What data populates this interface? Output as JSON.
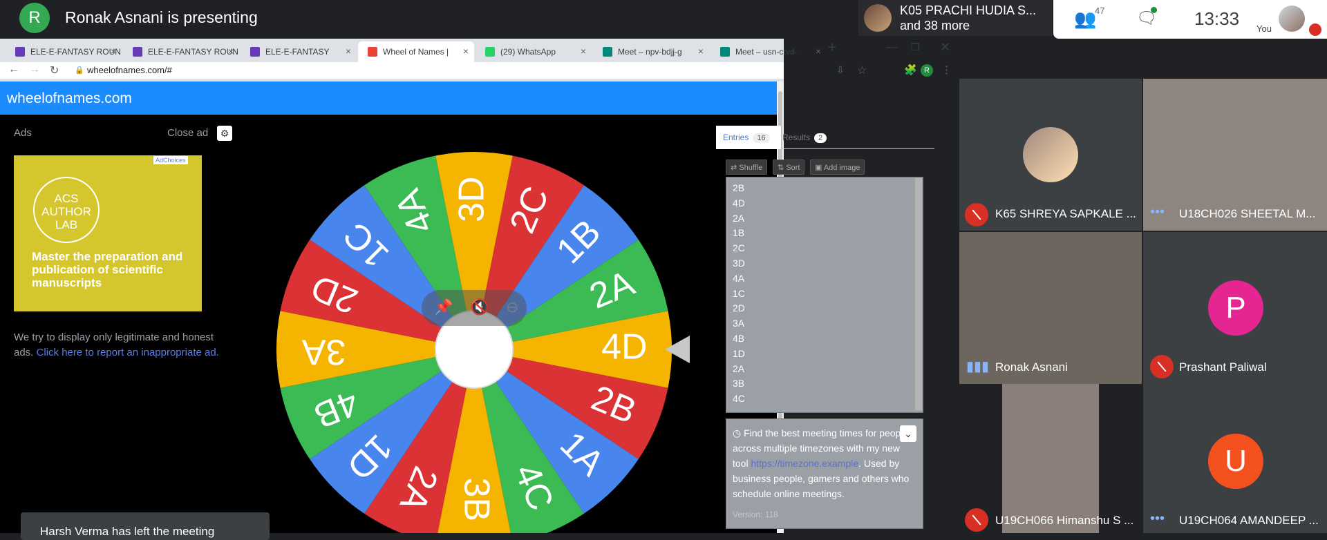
{
  "meet": {
    "presenter_initial": "R",
    "presenting_text": "Ronak Asnani is presenting",
    "others_name": "K05 PRACHI HUDIA S...",
    "others_more": "and 38 more",
    "people_count": "47",
    "time": "13:33",
    "you_label": "You"
  },
  "browser": {
    "tabs": [
      {
        "label": "ELE-E-FANTASY ROUN",
        "color": "#673ab7"
      },
      {
        "label": "ELE-E-FANTASY ROUN",
        "color": "#673ab7"
      },
      {
        "label": "ELE-E-FANTASY",
        "color": "#673ab7"
      },
      {
        "label": "Wheel of Names |",
        "color": "#ea4335"
      },
      {
        "label": "(29) WhatsApp",
        "color": "#25d366"
      },
      {
        "label": "Meet – npv-bdjj-g",
        "color": "#00897b"
      },
      {
        "label": "Meet – usn-ctvd-",
        "color": "#00897b"
      }
    ],
    "url": "wheelofnames.com/#",
    "profile_initial": "R"
  },
  "site": {
    "title": "wheelofnames.com",
    "ads_label": "Ads",
    "close_ad_label": "Close ad",
    "ad_logo_text": "ACS AUTHOR LAB",
    "ad_headline": "Master the preparation and publication of scientific manuscripts",
    "adchoices": "AdChoices",
    "disclaimer": "We try to display only legitimate and honest ads.",
    "report_link": "Click here to report an inappropriate ad.",
    "toast": "Harsh Verma has left the meeting"
  },
  "panel": {
    "entries_tab": "Entries",
    "entries_count": "16",
    "results_tab": "Results",
    "results_count": "2",
    "shuffle": "Shuffle",
    "sort": "Sort",
    "add_image": "Add image",
    "entries": [
      "2B",
      "4D",
      "2A",
      "1B",
      "2C",
      "3D",
      "4A",
      "1C",
      "2D",
      "3A",
      "4B",
      "1D",
      "2A",
      "3B",
      "4C"
    ],
    "info": "Find the best meeting times for people across multiple timezones with my new tool",
    "info_link": "https://timezone.example",
    "info_tail": ". Used by business people, gamers and others who schedule online meetings.",
    "version": "Version: 118"
  },
  "wheel": {
    "segments": [
      {
        "label": "4D",
        "color": "#f4b400"
      },
      {
        "label": "2B",
        "color": "#db3236"
      },
      {
        "label": "1A",
        "color": "#4885ed"
      },
      {
        "label": "4C",
        "color": "#3cba54"
      },
      {
        "label": "3B",
        "color": "#f4b400"
      },
      {
        "label": "2A",
        "color": "#db3236"
      },
      {
        "label": "1D",
        "color": "#4885ed"
      },
      {
        "label": "4B",
        "color": "#3cba54"
      },
      {
        "label": "3A",
        "color": "#f4b400"
      },
      {
        "label": "2D",
        "color": "#db3236"
      },
      {
        "label": "1C",
        "color": "#4885ed"
      },
      {
        "label": "4A",
        "color": "#3cba54"
      },
      {
        "label": "3D",
        "color": "#f4b400"
      },
      {
        "label": "2C",
        "color": "#db3236"
      },
      {
        "label": "1B",
        "color": "#4885ed"
      },
      {
        "label": "2A",
        "color": "#3cba54"
      }
    ]
  },
  "participants": [
    {
      "name": "K65 SHREYA SAPKALE ...",
      "muted": true
    },
    {
      "name": "U18CH026 SHEETAL M...",
      "muted": false
    },
    {
      "name": "Ronak Asnani",
      "muted": false
    },
    {
      "name": "Prashant Paliwal",
      "muted": true,
      "initial": "P",
      "avatar_color": "#e52592"
    },
    {
      "name": "U19CH066 Himanshu S ...",
      "muted": true
    },
    {
      "name": "U19CH064 AMANDEEP ...",
      "muted": false,
      "initial": "U",
      "avatar_color": "#f4511e"
    }
  ]
}
